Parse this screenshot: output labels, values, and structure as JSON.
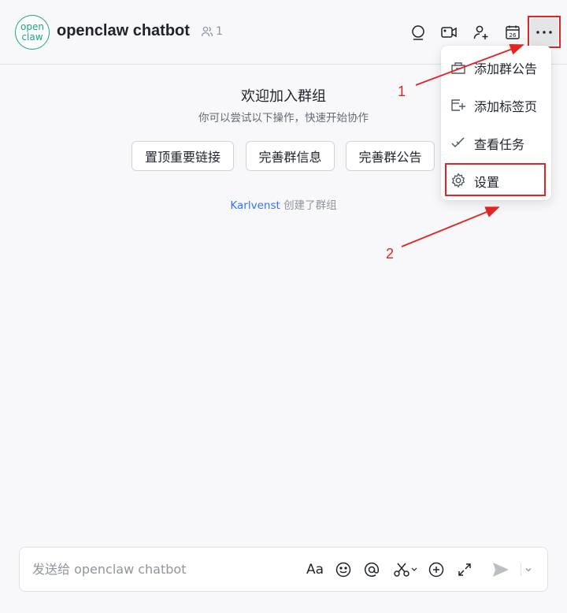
{
  "header": {
    "avatar_line1": "open",
    "avatar_line2": "claw",
    "title": "openclaw chatbot",
    "member_count": "1",
    "icons": [
      "search-icon",
      "video-call-icon",
      "add-member-icon",
      "calendar-icon",
      "more-icon"
    ],
    "calendar_day": "26"
  },
  "main": {
    "welcome_title": "欢迎加入群组",
    "welcome_subtitle": "你可以尝试以下操作，快速开始协作",
    "quick_actions": [
      "置顶重要链接",
      "完善群信息",
      "完善群公告"
    ],
    "system_message": {
      "user": "Karlvenst",
      "action": "创建了群组"
    }
  },
  "dropdown_menu": {
    "items": [
      {
        "label": "添加群公告",
        "icon": "announcement-icon"
      },
      {
        "label": "添加标签页",
        "icon": "add-tab-icon"
      },
      {
        "label": "查看任务",
        "icon": "task-icon"
      },
      {
        "label": "设置",
        "icon": "settings-gear-icon"
      }
    ]
  },
  "annotations": {
    "step1": "1",
    "step2": "2",
    "color": "#e02525"
  },
  "composer": {
    "placeholder": "发送给 openclaw chatbot",
    "text_format_label": "Aa",
    "icons": [
      "text-format-icon",
      "emoji-icon",
      "mention-icon",
      "screenshot-icon",
      "add-icon",
      "expand-icon",
      "send-icon",
      "chevron-down-icon"
    ]
  },
  "colors": {
    "brand_green": "#17a589",
    "link_blue": "#3370ff",
    "annotation_red": "#e02525"
  }
}
